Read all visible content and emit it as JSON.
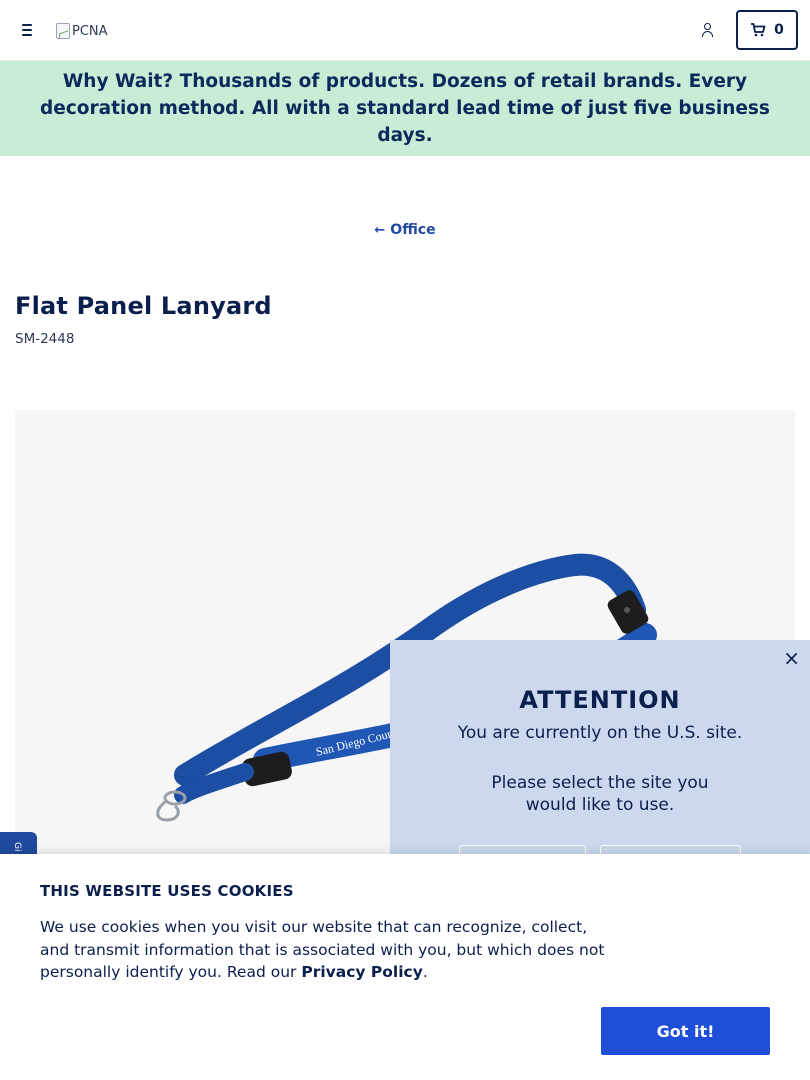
{
  "header": {
    "logo_alt": "PCNA",
    "cart_count": "0"
  },
  "promo": {
    "lead": "Why Wait?",
    "text": " Thousands of products. Dozens of retail brands. Every decoration method. All with a standard lead time of just five business days."
  },
  "breadcrumb": {
    "back_label": "Office"
  },
  "product": {
    "title": "Flat Panel Lanyard",
    "sku": "SM-2448",
    "image_alt": "Flat Panel Lanyard",
    "lanyard_color": "#1c4ea3",
    "print_text": "San Diego County Credit Union"
  },
  "feedback_tab": {
    "label": "Gi"
  },
  "site_modal": {
    "close_icon": "close-icon",
    "heading": "ATTENTION",
    "line1": "You are currently on the U.S. site.",
    "line2": "Please select the site you would like to use."
  },
  "cookie_banner": {
    "title": "THIS WEBSITE USES COOKIES",
    "text_before": "We use cookies when you visit our website that can recognize, collect, and transmit information that is associated with you, but which does not personally identify you. Read our ",
    "link_label": "Privacy Policy",
    "text_after": ".",
    "button_label": "Got it!"
  },
  "colors": {
    "primary": "#0b1f4d",
    "promo_bg": "#c9ecd6",
    "modal_bg": "#cbd8ee",
    "button_blue": "#1f4ed8"
  }
}
